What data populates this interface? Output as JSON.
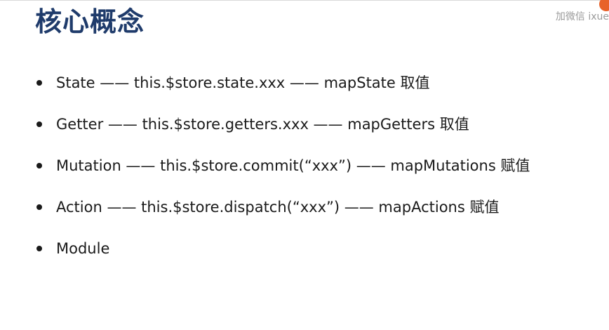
{
  "slide": {
    "title": "核心概念",
    "watermark": "加微信 ixue",
    "items": [
      "State —— this.$store.state.xxx —— mapState  取值",
      "Getter —— this.$store.getters.xxx —— mapGetters 取值",
      "Mutation —— this.$store.commit(“xxx”) —— mapMutations 赋值",
      "Action —— this.$store.dispatch(“xxx”) —— mapActions 赋值",
      "Module"
    ]
  },
  "colors": {
    "title": "#1f3b6b",
    "text": "#1a1a1a",
    "watermark": "#9a9a9a",
    "logo": "#e8622a"
  }
}
